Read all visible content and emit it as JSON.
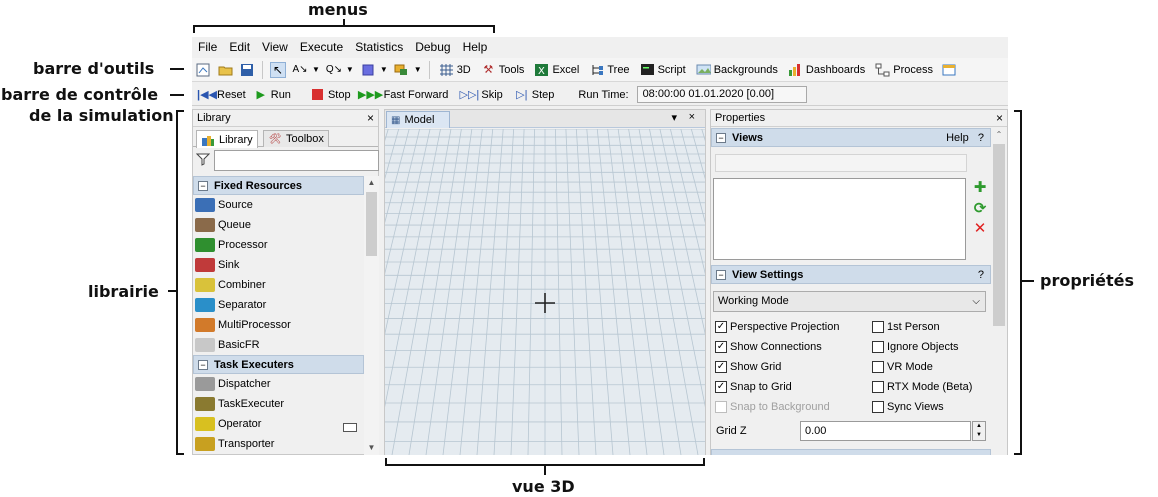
{
  "annotations": {
    "menus": "menus",
    "toolbar": "barre d'outils",
    "simbar_line1": "barre de contrôle",
    "simbar_line2": "de la simulation",
    "library": "librairie",
    "view3d": "vue 3D",
    "properties": "propriétés"
  },
  "menubar": {
    "items": [
      "File",
      "Edit",
      "View",
      "Execute",
      "Statistics",
      "Debug",
      "Help"
    ]
  },
  "toolbar": {
    "icons": [
      "new-model-icon",
      "open-folder-icon",
      "save-icon",
      "pointer-icon",
      "connect-objects-icon",
      "disconnect-icon",
      "select-box-icon",
      "create-object-icon"
    ],
    "buttons": [
      {
        "label": "3D",
        "icon": "grid-3d-icon"
      },
      {
        "label": "Tools",
        "icon": "tools-icon"
      },
      {
        "label": "Excel",
        "icon": "excel-icon"
      },
      {
        "label": "Tree",
        "icon": "tree-icon"
      },
      {
        "label": "Script",
        "icon": "script-icon"
      },
      {
        "label": "Backgrounds",
        "icon": "backgrounds-icon"
      },
      {
        "label": "Dashboards",
        "icon": "dashboards-icon"
      },
      {
        "label": "Process",
        "icon": "process-icon"
      }
    ]
  },
  "simbar": {
    "reset": "Reset",
    "run": "Run",
    "stop": "Stop",
    "fast_forward": "Fast Forward",
    "skip": "Skip",
    "step": "Step",
    "run_time_label": "Run Time:",
    "run_time_value": "08:00:00  01.01.2020  [0.00]"
  },
  "library": {
    "title": "Library",
    "close": "×",
    "tabs": [
      "Library",
      "Toolbox"
    ],
    "search_value": "",
    "sections": [
      {
        "title": "Fixed Resources",
        "items": [
          {
            "label": "Source",
            "color": "#3b6fb6"
          },
          {
            "label": "Queue",
            "color": "#8a6a4a"
          },
          {
            "label": "Processor",
            "color": "#2f8f2f"
          },
          {
            "label": "Sink",
            "color": "#c03a3a"
          },
          {
            "label": "Combiner",
            "color": "#d9c23a"
          },
          {
            "label": "Separator",
            "color": "#2a8fc9"
          },
          {
            "label": "MultiProcessor",
            "color": "#d27a2a"
          },
          {
            "label": "BasicFR",
            "color": "#c8c8c8"
          }
        ]
      },
      {
        "title": "Task Executers",
        "items": [
          {
            "label": "Dispatcher",
            "color": "#9a9a9a"
          },
          {
            "label": "TaskExecuter",
            "color": "#8a7a30"
          },
          {
            "label": "Operator",
            "color": "#d8c020"
          },
          {
            "label": "Transporter",
            "color": "#c8a020"
          }
        ]
      }
    ]
  },
  "model": {
    "tab_label": "Model",
    "menu": "▾",
    "close": "×",
    "grid_color": "#b7c6d1",
    "bg_color": "#e5ebf0"
  },
  "properties": {
    "title": "Properties",
    "close": "×",
    "views_section": "Views",
    "help": "Help",
    "help_q": "?",
    "views_name": "",
    "view_settings_section": "View Settings",
    "view_settings_q": "?",
    "mode_select": "Working Mode",
    "checkboxes": [
      {
        "label": "Perspective Projection",
        "checked": true,
        "disabled": false
      },
      {
        "label": "1st Person",
        "checked": false,
        "disabled": false
      },
      {
        "label": "Show Connections",
        "checked": true,
        "disabled": false
      },
      {
        "label": "Ignore Objects",
        "checked": false,
        "disabled": false
      },
      {
        "label": "Show Grid",
        "checked": true,
        "disabled": false
      },
      {
        "label": "VR Mode",
        "checked": false,
        "disabled": false
      },
      {
        "label": "Snap to Grid",
        "checked": true,
        "disabled": false
      },
      {
        "label": "RTX Mode (Beta)",
        "checked": false,
        "disabled": false
      },
      {
        "label": "Snap to Background",
        "checked": false,
        "disabled": true
      },
      {
        "label": "Sync Views",
        "checked": false,
        "disabled": false
      }
    ],
    "grid_z_label": "Grid Z",
    "grid_z_value": "0.00"
  }
}
